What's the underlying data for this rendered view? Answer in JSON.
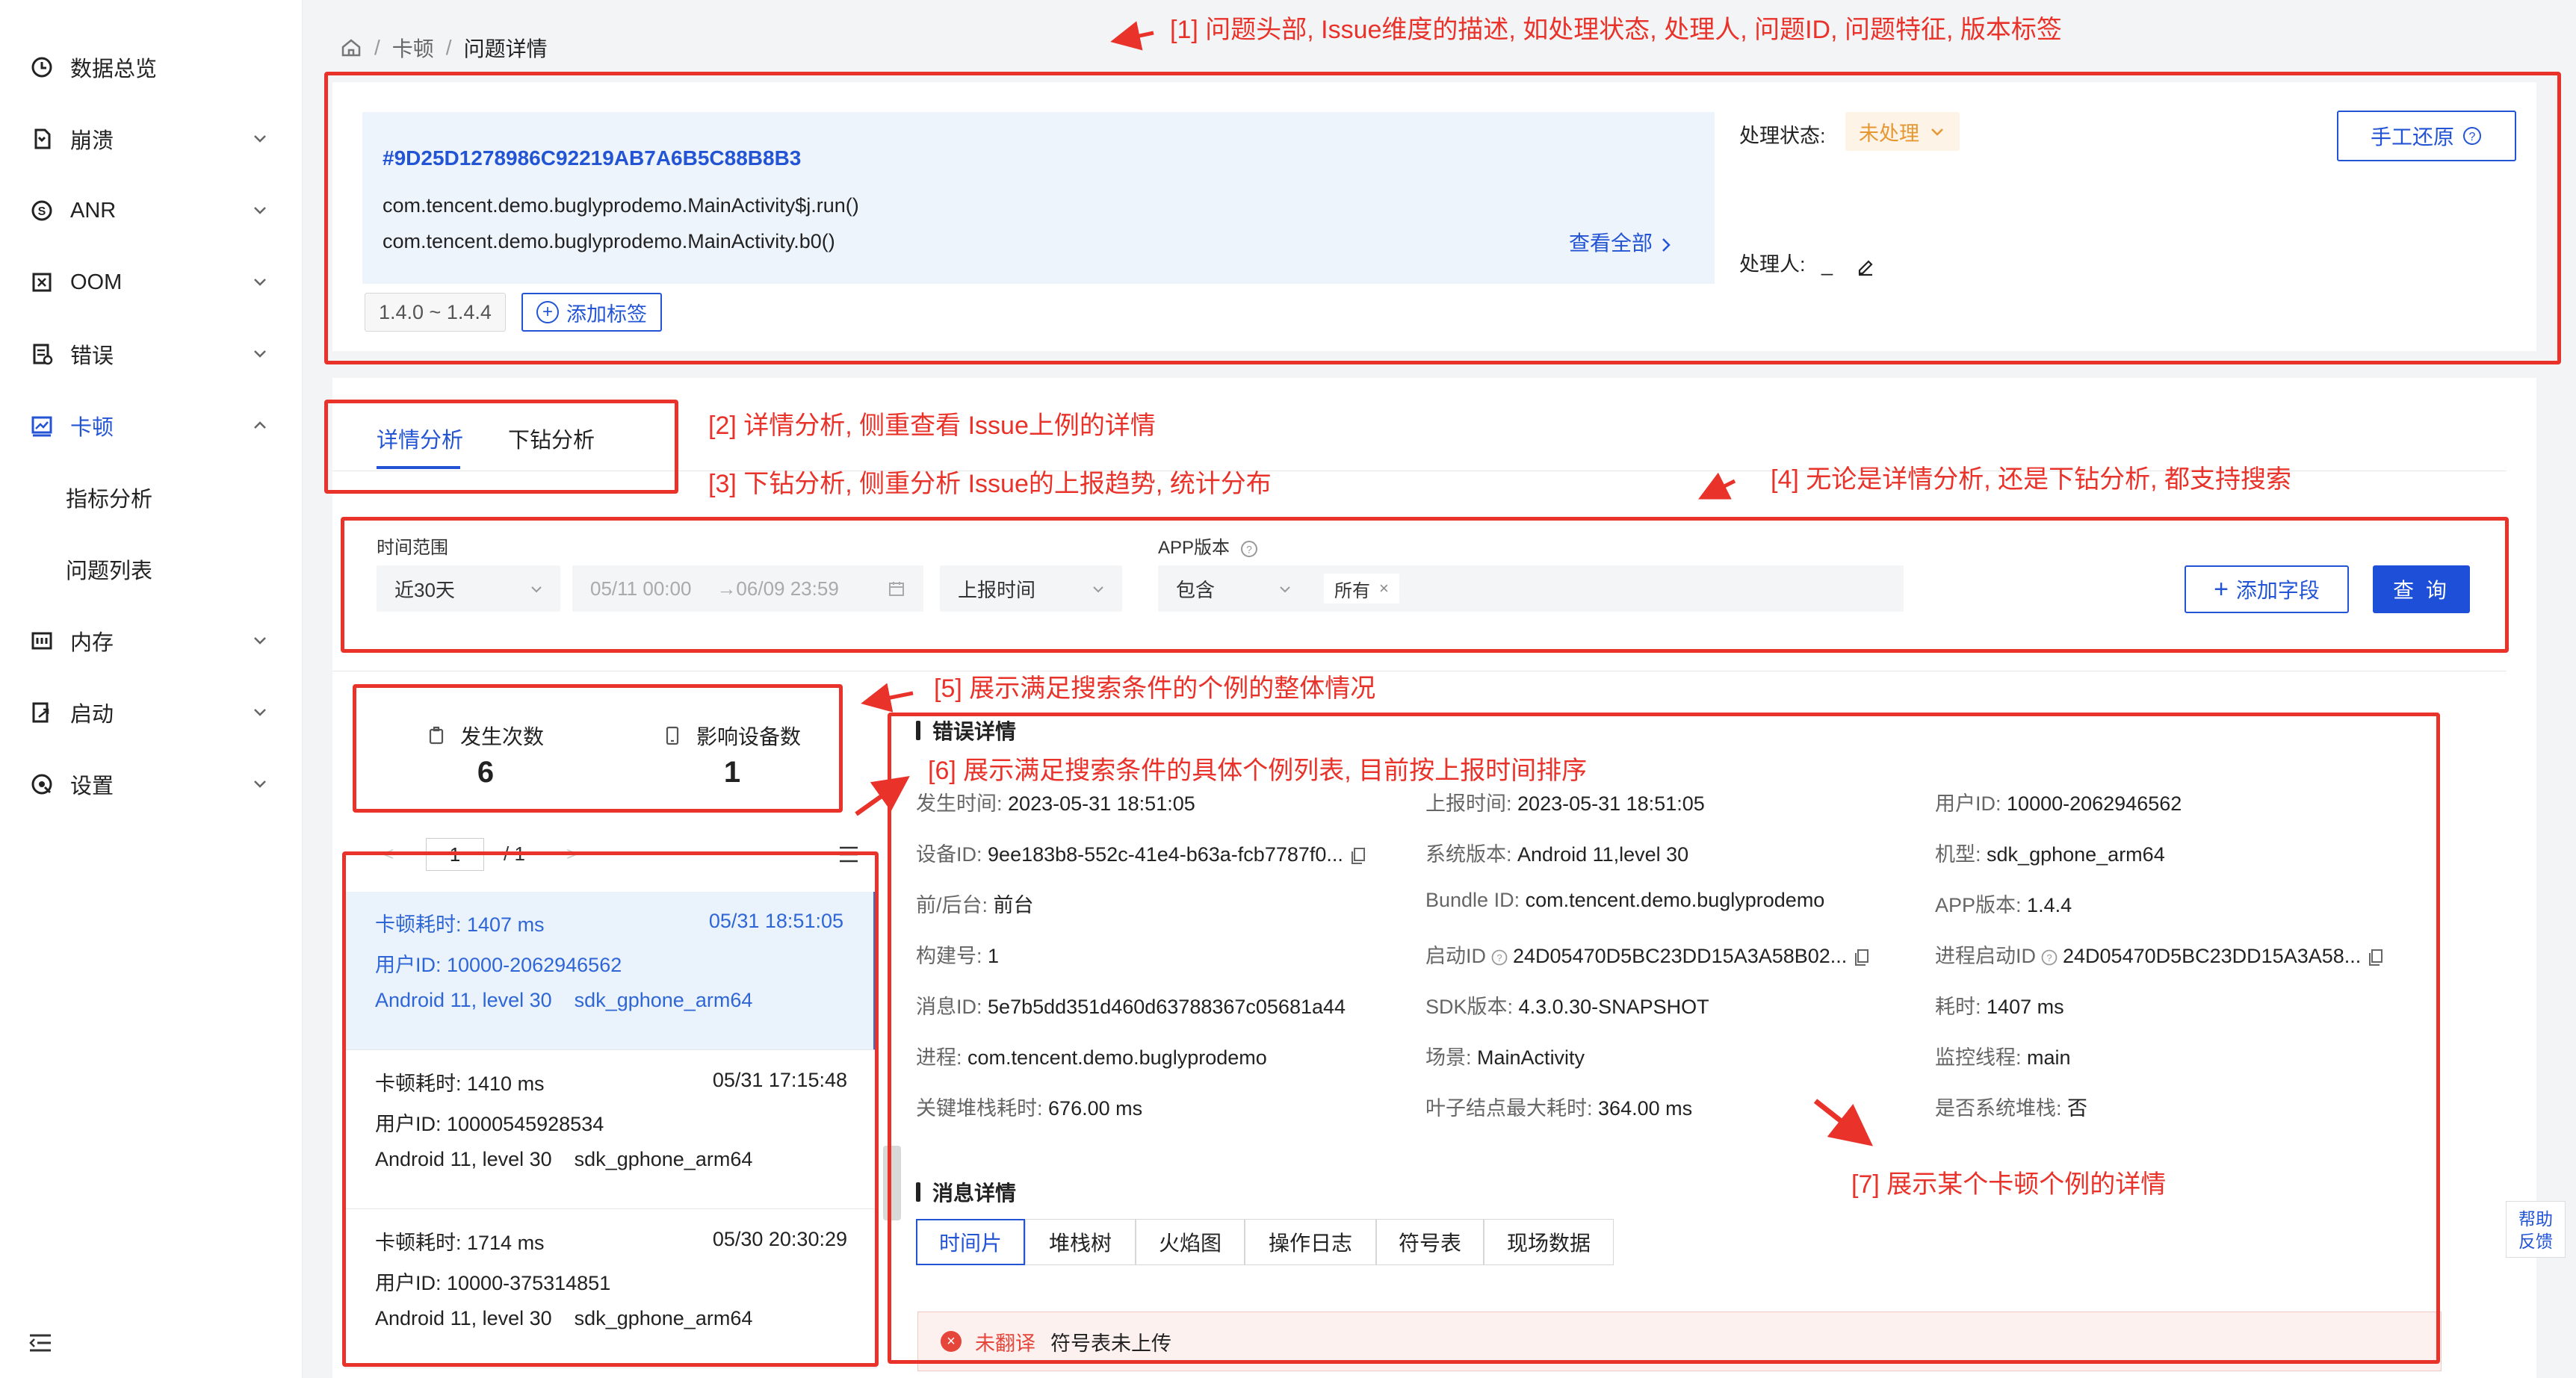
{
  "sidebar": {
    "items": [
      {
        "label": "数据总览",
        "icon": "dashboard-icon"
      },
      {
        "label": "崩溃",
        "icon": "crash-icon"
      },
      {
        "label": "ANR",
        "icon": "anr-icon"
      },
      {
        "label": "OOM",
        "icon": "oom-icon"
      },
      {
        "label": "错误",
        "icon": "error-icon"
      },
      {
        "label": "卡顿",
        "icon": "lag-icon"
      },
      {
        "label": "内存",
        "icon": "memory-icon"
      },
      {
        "label": "启动",
        "icon": "launch-icon"
      },
      {
        "label": "设置",
        "icon": "settings-icon"
      }
    ],
    "sub_items": [
      "指标分析",
      "问题列表"
    ]
  },
  "breadcrumb": {
    "items": [
      "卡顿",
      "问题详情"
    ]
  },
  "header": {
    "issue_id": "#9D25D1278986C92219AB7A6B5C88B8B3",
    "stack_lines": [
      "com.tencent.demo.buglyprodemo.MainActivity$j.run()",
      "com.tencent.demo.buglyprodemo.MainActivity.b0()"
    ],
    "view_all": "查看全部",
    "version_tag": "1.4.0 ~ 1.4.4",
    "add_tag": "添加标签",
    "status_label": "处理状态:",
    "status_value": "未处理",
    "handler_label": "处理人:",
    "handler_value": "_",
    "manual_button": "手工还原"
  },
  "tabs": [
    "详情分析",
    "下钻分析"
  ],
  "filters": {
    "time_range_label": "时间范围",
    "time_range_value": "近30天",
    "date_start": "05/11 00:00",
    "date_end": "→06/09 23:59",
    "time_field": "上报时间",
    "app_version_label": "APP版本",
    "app_version_op": "包含",
    "app_version_value": "所有",
    "add_field": "添加字段",
    "query": "查 询"
  },
  "summary": {
    "occurrences_label": "发生次数",
    "occurrences_value": "6",
    "devices_label": "影响设备数",
    "devices_value": "1"
  },
  "pager": {
    "current": "1",
    "total": "/ 1",
    "prev": "<",
    "next": ">"
  },
  "cases": [
    {
      "lag": "卡顿耗时: 1407 ms",
      "time": "05/31 18:51:05",
      "user": "用户ID: 10000-2062946562",
      "os": "Android 11, level 30",
      "model": "sdk_gphone_arm64"
    },
    {
      "lag": "卡顿耗时: 1410 ms",
      "time": "05/31 17:15:48",
      "user": "用户ID: 10000545928534",
      "os": "Android 11, level 30",
      "model": "sdk_gphone_arm64"
    },
    {
      "lag": "卡顿耗时: 1714 ms",
      "time": "05/30 20:30:29",
      "user": "用户ID: 10000-375314851",
      "os": "Android 11, level 30",
      "model": "sdk_gphone_arm64"
    }
  ],
  "error_detail": {
    "title": "错误详情",
    "fields": [
      {
        "k": "发生时间:",
        "v": "2023-05-31 18:51:05"
      },
      {
        "k": "上报时间:",
        "v": "2023-05-31 18:51:05"
      },
      {
        "k": "用户ID:",
        "v": "10000-2062946562"
      },
      {
        "k": "设备ID:",
        "v": "9ee183b8-552c-41e4-b63a-fcb7787f0..."
      },
      {
        "k": "系统版本:",
        "v": "Android 11,level 30"
      },
      {
        "k": "机型:",
        "v": "sdk_gphone_arm64"
      },
      {
        "k": "前/后台:",
        "v": "前台"
      },
      {
        "k": "Bundle ID:",
        "v": "com.tencent.demo.buglyprodemo"
      },
      {
        "k": "APP版本:",
        "v": "1.4.4"
      },
      {
        "k": "构建号:",
        "v": "1"
      },
      {
        "k": "启动ID",
        "v": "24D05470D5BC23DD15A3A58B02..."
      },
      {
        "k": "进程启动ID",
        "v": "24D05470D5BC23DD15A3A58..."
      },
      {
        "k": "消息ID:",
        "v": "5e7b5dd351d460d63788367c05681a44"
      },
      {
        "k": "SDK版本:",
        "v": "4.3.0.30-SNAPSHOT"
      },
      {
        "k": "耗时:",
        "v": "1407 ms"
      },
      {
        "k": "进程:",
        "v": "com.tencent.demo.buglyprodemo"
      },
      {
        "k": "场景:",
        "v": "MainActivity"
      },
      {
        "k": "监控线程:",
        "v": "main"
      },
      {
        "k": "关键堆栈耗时:",
        "v": "676.00 ms"
      },
      {
        "k": "叶子结点最大耗时:",
        "v": "364.00 ms"
      },
      {
        "k": "是否系统堆栈:",
        "v": "否"
      }
    ]
  },
  "message_detail": {
    "title": "消息详情",
    "tabs": [
      "时间片",
      "堆栈树",
      "火焰图",
      "操作日志",
      "符号表",
      "现场数据"
    ]
  },
  "warning": {
    "tag": "未翻译",
    "text": "符号表未上传"
  },
  "help_feedback": {
    "line1": "帮助",
    "line2": "反馈"
  },
  "annotations": [
    "[1] 问题头部, Issue维度的描述, 如处理状态, 处理人, 问题ID, 问题特征, 版本标签",
    "[2] 详情分析, 侧重查看 Issue上例的详情",
    "[3] 下钻分析, 侧重分析 Issue的上报趋势, 统计分布",
    "[4] 无论是详情分析, 还是下钻分析, 都支持搜索",
    "[5] 展示满足搜索条件的个例的整体情况",
    "[6] 展示满足搜索条件的具体个例列表, 目前按上报时间排序",
    "[7] 展示某个卡顿个例的详情"
  ],
  "colors": {
    "accent": "#2254d4",
    "annotation": "#e8322a",
    "status": "#e79732"
  }
}
